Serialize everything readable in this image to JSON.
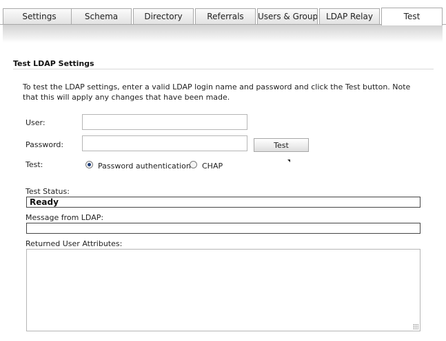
{
  "tabs": [
    {
      "label": "Settings",
      "active": false
    },
    {
      "label": "Schema",
      "active": false
    },
    {
      "label": "Directory",
      "active": false
    },
    {
      "label": "Referrals",
      "active": false
    },
    {
      "label": "Users & Groups",
      "active": false
    },
    {
      "label": "LDAP Relay",
      "active": false
    },
    {
      "label": "Test",
      "active": true
    }
  ],
  "section": {
    "title": "Test LDAP Settings",
    "intro": "To test the LDAP settings, enter a valid LDAP login name and password and click the Test button. Note that this will apply any changes that have been made."
  },
  "form": {
    "user_label": "User:",
    "user_value": "",
    "password_label": "Password:",
    "password_value": "",
    "test_button": "Test",
    "test_label": "Test:",
    "options": [
      {
        "label": "Password authentication",
        "checked": true
      },
      {
        "label": "CHAP",
        "checked": false
      }
    ]
  },
  "results": {
    "status_label": "Test Status:",
    "status_value": "Ready",
    "message_label": "Message from LDAP:",
    "message_value": "",
    "attributes_label": "Returned User Attributes:",
    "attributes_value": ""
  },
  "colors": {
    "radio_selected": "#1f3f7a",
    "tab_border": "#a9a9a9"
  }
}
